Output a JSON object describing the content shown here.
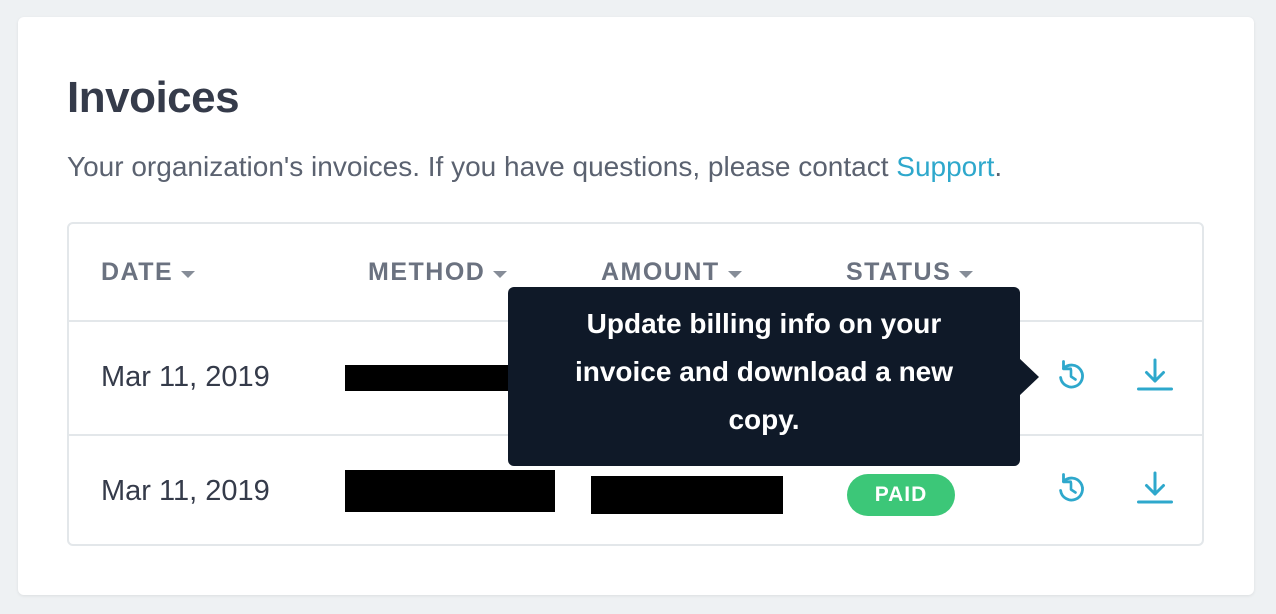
{
  "page": {
    "title": "Invoices",
    "subtitle_prefix": "Your organization's invoices. If you have questions, please contact ",
    "support_link": "Support",
    "subtitle_suffix": "."
  },
  "table": {
    "columns": [
      "DATE",
      "METHOD",
      "AMOUNT",
      "STATUS"
    ],
    "rows": [
      {
        "date": "Mar 11, 2019",
        "method": "[redacted]",
        "amount": "[redacted]",
        "status": "",
        "actions": [
          "regenerate-icon",
          "download-icon"
        ]
      },
      {
        "date": "Mar 11, 2019",
        "method": "[redacted]",
        "amount": "[redacted]",
        "status": "PAID",
        "actions": [
          "regenerate-icon",
          "download-icon"
        ]
      }
    ]
  },
  "tooltip": {
    "text": "Update billing info on your invoice and download a new copy."
  },
  "colors": {
    "accent": "#2ea8cc",
    "status_paid": "#3cc778",
    "tooltip_bg": "#0f1928",
    "heading": "#353b4a"
  }
}
